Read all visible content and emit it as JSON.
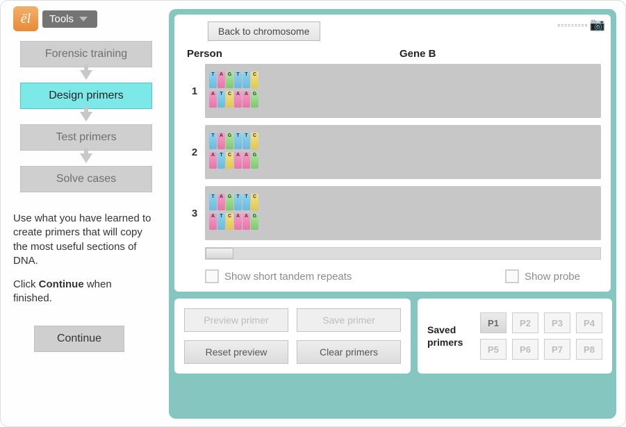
{
  "header": {
    "tools": "Tools"
  },
  "sidebar": {
    "steps": [
      "Forensic training",
      "Design primers",
      "Test primers",
      "Solve cases"
    ],
    "activeStep": 1,
    "instruction1": "Use what you have learned to create primers that will copy the most useful sections of DNA.",
    "instruction2a": "Click",
    "continueBold": "Continue",
    "instruction2b": "when finished.",
    "continue": "Continue"
  },
  "main": {
    "back": "Back to chromosome",
    "headers": {
      "person": "Person",
      "gene": "Gene B"
    },
    "rows": [
      "1",
      "2",
      "3"
    ],
    "options": {
      "str": "Show short tandem repeats",
      "probe": "Show probe"
    },
    "actions": {
      "preview": "Preview primer",
      "save": "Save primer",
      "reset": "Reset preview",
      "clear": "Clear primers"
    },
    "saved": {
      "label": "Saved primers",
      "slots": [
        "P1",
        "P2",
        "P3",
        "P4",
        "P5",
        "P6",
        "P7",
        "P8"
      ],
      "active": "P1"
    }
  },
  "colors": {
    "accent": "#7de8e8",
    "frame": "#86c6c0",
    "step": "#cfcfcf"
  }
}
